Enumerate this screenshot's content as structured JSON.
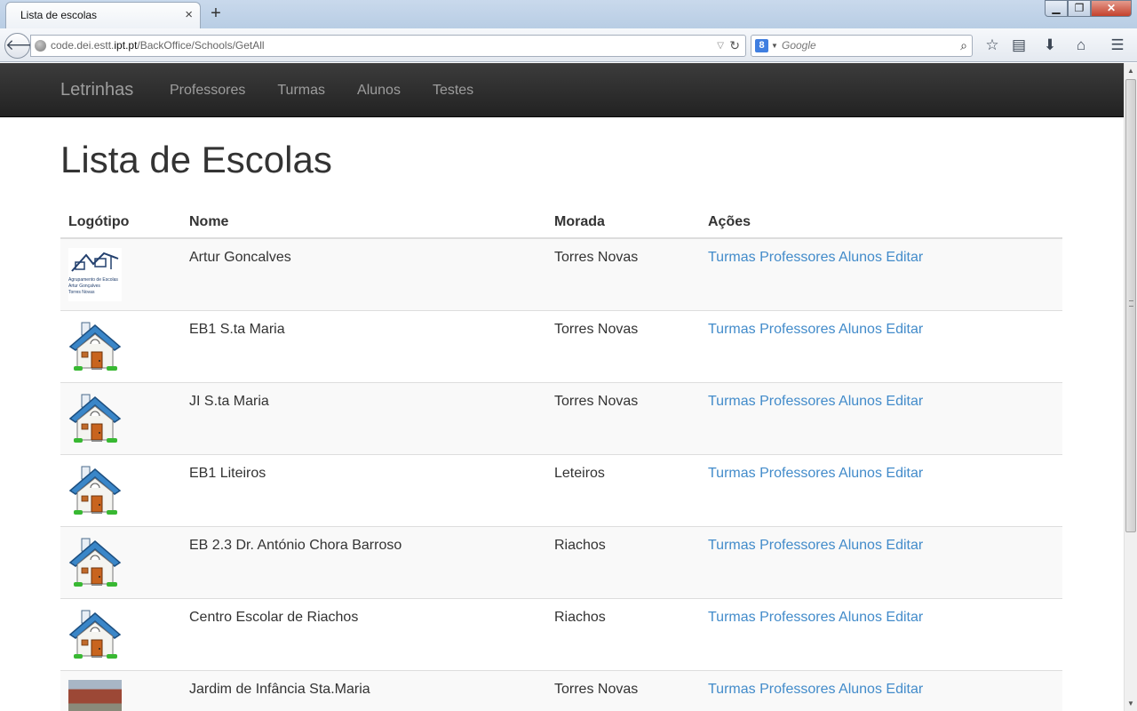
{
  "browser": {
    "tab_title": "Lista de escolas",
    "tab_close": "×",
    "new_tab": "+",
    "url_prefix": "code.dei.estt.",
    "url_host": "ipt.pt",
    "url_path": "/BackOffice/Schools/GetAll",
    "search_placeholder": "Google",
    "search_engine_letter": "8"
  },
  "site": {
    "brand": "Letrinhas",
    "nav": [
      "Professores",
      "Turmas",
      "Alunos",
      "Testes"
    ]
  },
  "page": {
    "title": "Lista de Escolas"
  },
  "table": {
    "headers": [
      "Logótipo",
      "Nome",
      "Morada",
      "Ações"
    ],
    "actions": [
      "Turmas",
      "Professores",
      "Alunos",
      "Editar"
    ],
    "rows": [
      {
        "logo": "artur",
        "name": "Artur Goncalves",
        "address": "Torres Novas"
      },
      {
        "logo": "school-house",
        "name": "EB1 S.ta Maria",
        "address": "Torres Novas"
      },
      {
        "logo": "school-house",
        "name": "JI S.ta Maria",
        "address": "Torres Novas"
      },
      {
        "logo": "school-house",
        "name": "EB1 Liteiros",
        "address": "Leteiros"
      },
      {
        "logo": "school-house",
        "name": "EB 2.3 Dr. António Chora Barroso",
        "address": "Riachos"
      },
      {
        "logo": "school-house",
        "name": "Centro Escolar de Riachos",
        "address": "Riachos"
      },
      {
        "logo": "photo",
        "name": "Jardim de Infância Sta.Maria",
        "address": "Torres Novas"
      }
    ],
    "artur_logo_lines": [
      "Agrupamento de Escolas",
      "Artur Gonçalves",
      "Torres Novas"
    ]
  },
  "colors": {
    "link": "#428bca",
    "navbar": "#222222",
    "nav_text": "#9d9d9d"
  }
}
